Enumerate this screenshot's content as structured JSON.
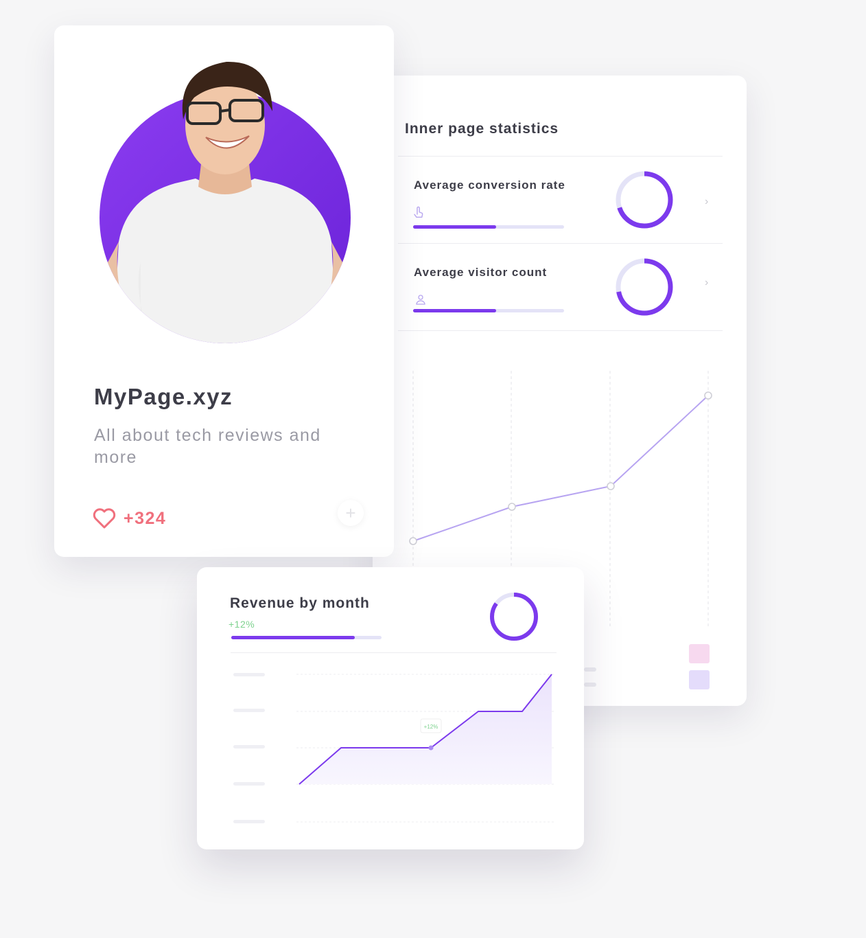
{
  "profile": {
    "site_name": "MyPage.xyz",
    "tagline": "All about tech reviews and more",
    "likes": "+324",
    "icons": {
      "like": "heart-icon",
      "add": "plus-icon"
    },
    "avatar_bg_color": "#7c3aed"
  },
  "stats": {
    "title": "Inner page statistics",
    "metrics": [
      {
        "label": "Average conversion rate",
        "icon": "pointer-icon",
        "progress": 0.55,
        "donut_fraction": 0.7
      },
      {
        "label": "Average visitor count",
        "icon": "user-icon",
        "progress": 0.55,
        "donut_fraction": 0.72
      }
    ],
    "legend_colors": [
      "#f7d9ef",
      "#e4dcfb"
    ]
  },
  "revenue": {
    "title": "Revenue by month",
    "change": "+12%",
    "progress": 0.82,
    "donut_fraction": 0.85,
    "tooltip": "+12%"
  },
  "colors": {
    "accent": "#7c3aed",
    "accent_light": "#e4e3f7",
    "like": "#f0707d",
    "positive": "#7ed28f"
  }
}
